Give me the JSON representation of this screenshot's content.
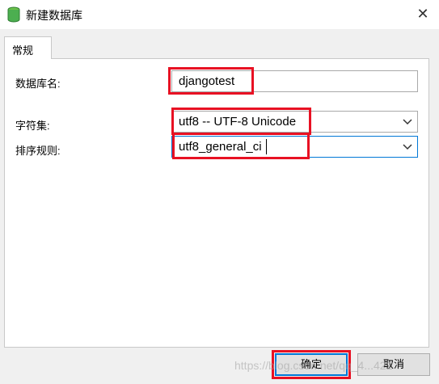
{
  "window": {
    "title": "新建数据库",
    "close_icon": "close-icon",
    "app_icon": "database-icon"
  },
  "tabs": [
    {
      "label": "常规"
    }
  ],
  "form": {
    "db_name": {
      "label": "数据库名:",
      "value": "djangotest"
    },
    "charset": {
      "label": "字符集:",
      "value": "utf8 -- UTF-8 Unicode"
    },
    "collation": {
      "label": "排序规则:",
      "value": "utf8_general_ci"
    }
  },
  "buttons": {
    "ok": "确定",
    "cancel": "取消"
  },
  "watermark": "https://blog.csdn.net/qq_4...421",
  "colors": {
    "highlight": "#e81123",
    "focus": "#0078d7",
    "db_icon": "#4caf50"
  }
}
